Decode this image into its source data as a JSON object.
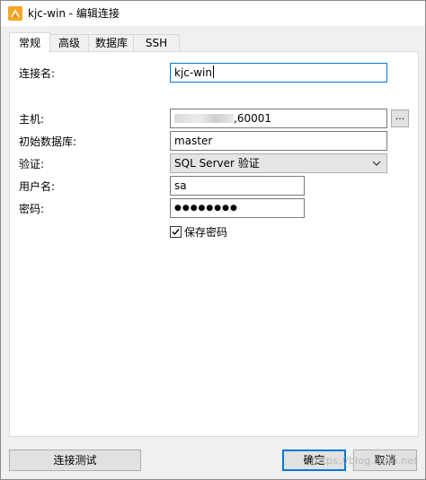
{
  "window": {
    "title": "kjc-win - 编辑连接"
  },
  "tabs": [
    {
      "label": "常规",
      "active": true
    },
    {
      "label": "高级",
      "active": false
    },
    {
      "label": "数据库",
      "active": false
    },
    {
      "label": "SSH",
      "active": false
    }
  ],
  "form": {
    "connection_name": {
      "label": "连接名:",
      "value": "kjc-win"
    },
    "host": {
      "label": "主机:",
      "value_suffix": ",60001",
      "browse_label": "..."
    },
    "initial_database": {
      "label": "初始数据库:",
      "value": "master"
    },
    "auth": {
      "label": "验证:",
      "value": "SQL Server 验证"
    },
    "username": {
      "label": "用户名:",
      "value": "sa"
    },
    "password": {
      "label": "密码:",
      "masked_value": "●●●●●●●●"
    },
    "save_password": {
      "label": "保存密码",
      "checked": true
    }
  },
  "footer": {
    "test_label": "连接测试",
    "ok_label": "确定",
    "cancel_label": "取消"
  },
  "watermark": "https://blog.csdn.net",
  "colors": {
    "focus_border": "#0078d7",
    "panel_bg": "#ffffff",
    "window_bg": "#f0f0f0",
    "app_icon": "#f5a623"
  }
}
